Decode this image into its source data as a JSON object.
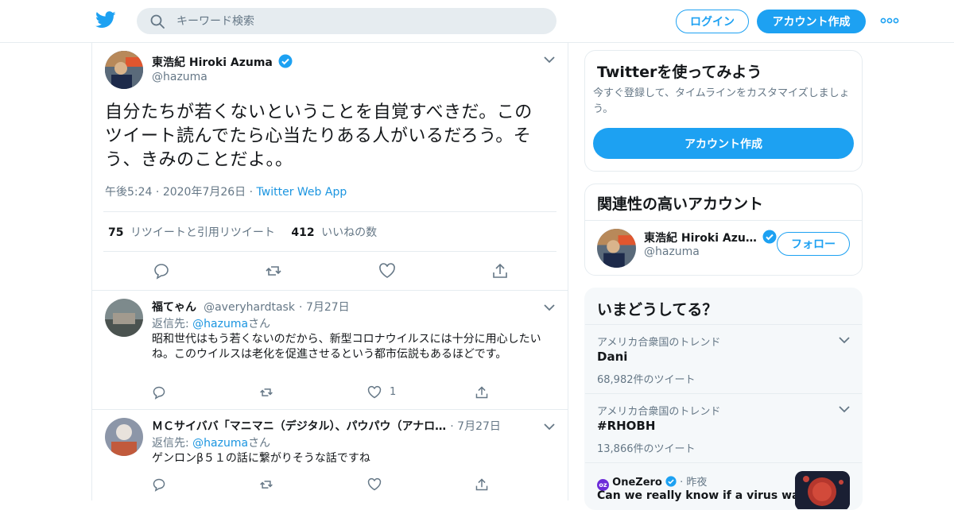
{
  "header": {
    "search_placeholder": "キーワード検索",
    "login_label": "ログイン",
    "signup_label": "アカウント作成"
  },
  "tweet": {
    "author_name": "東浩紀 Hiroki Azuma",
    "author_handle": "@hazuma",
    "text": "自分たちが若くないということを自覚すべきだ。このツイート読んでたら心当たりある人がいるだろう。そう、きみのことだよ。。",
    "time": "午後5:24",
    "date": "2020年7月26日",
    "source": "Twitter Web App",
    "retweets_count": "75",
    "retweets_label": "リツイートと引用リツイート",
    "likes_count": "412",
    "likes_label": "いいねの数"
  },
  "replies": [
    {
      "author_name": "福てゃん",
      "author_handle": "@averyhardtask",
      "date": "7月27日",
      "reply_prefix": "返信先: ",
      "reply_to": "@hazuma",
      "reply_suffix": "さん",
      "text": "昭和世代はもう若くないのだから、新型コロナウイルスには十分に用心したいね。このウイルスは老化を促進させるという都市伝説もあるほどです。",
      "like_count": "1"
    },
    {
      "author_name": "ＭＣサイババ「マニマニ（デジタル）、パウパウ（アナロ…",
      "author_handle": "",
      "date": "7月27日",
      "reply_prefix": "返信先: ",
      "reply_to": "@hazuma",
      "reply_suffix": "さん",
      "text": "ゲンロンβ５１の話に繋がりそうな話ですね",
      "like_count": ""
    }
  ],
  "sidebar": {
    "signup_card": {
      "title": "Twitterを使ってみよう",
      "desc": "今すぐ登録して、タイムラインをカスタマイズしましょう。",
      "button": "アカウント作成"
    },
    "related": {
      "title": "関連性の高いアカウント",
      "name": "東浩紀 Hiroki Azu…",
      "handle": "@hazuma",
      "follow": "フォロー"
    },
    "trends": {
      "title": "いまどうしてる？",
      "items": [
        {
          "context": "アメリカ合衆国のトレンド",
          "name": "Dani",
          "count": "68,982件のツイート"
        },
        {
          "context": "アメリカ合衆国のトレンド",
          "name": "#RHOBH",
          "count": "13,866件のツイート"
        }
      ],
      "news": {
        "source": "OneZero",
        "time": "昨夜",
        "headline": "Can we really know if a virus was"
      }
    }
  },
  "colors": {
    "accent": "#1da1f2",
    "link": "#1b95e0",
    "secondary_text": "#657786",
    "border": "#e6ecf0"
  }
}
